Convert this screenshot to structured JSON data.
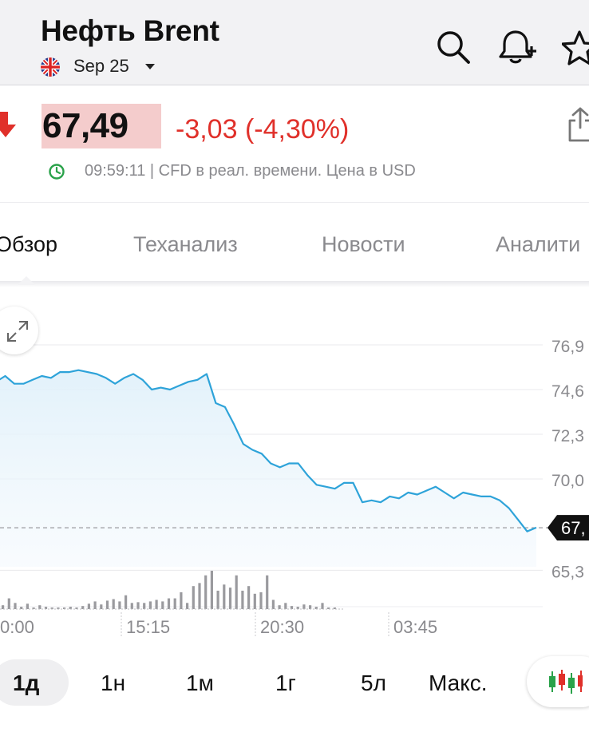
{
  "header": {
    "title": "Нефть Brent",
    "contract": "Sep 25"
  },
  "quote": {
    "price": "67,49",
    "change": "-3,03 (-4,30%)",
    "status": "09:59:11 | CFD в реал. времени. Цена в USD"
  },
  "tabs": [
    {
      "label": "Обзор",
      "active": true
    },
    {
      "label": "Теханализ",
      "active": false
    },
    {
      "label": "Новости",
      "active": false
    },
    {
      "label": "Аналити",
      "active": false
    }
  ],
  "ranges": [
    "1д",
    "1н",
    "1м",
    "1г",
    "5л",
    "Макс."
  ],
  "active_range": "1д",
  "colors": {
    "negative": "#e0302a",
    "line": "#2ea3d9",
    "price_highlight": "#f4cccc",
    "header_bg": "#f2f2f4"
  },
  "icons": [
    "uk-flag-icon",
    "chevron-down-icon",
    "search-icon",
    "bell-plus-icon",
    "star-icon",
    "down-arrow-icon",
    "share-icon",
    "clock-icon",
    "expand-icon",
    "candlestick-icon"
  ],
  "chart_data": {
    "type": "line",
    "y_tick_labels": [
      "76,9",
      "74,6",
      "72,3",
      "70,0",
      "65,3"
    ],
    "y_ticks": [
      76.9,
      74.6,
      72.3,
      70.0,
      65.3
    ],
    "current_label": "67,",
    "current_value": 67.49,
    "x_tick_labels": [
      "0:00",
      "15:15",
      "20:30",
      "03:45"
    ],
    "ylim": [
      65.3,
      76.9
    ],
    "grid": true,
    "series": [
      {
        "values": [
          75.0,
          75.3,
          74.9,
          74.9,
          75.1,
          75.3,
          75.2,
          75.5,
          75.5,
          75.6,
          75.5,
          75.4,
          75.2,
          74.9,
          75.2,
          75.4,
          75.1,
          74.6,
          74.7,
          74.6,
          74.8,
          75.0,
          75.1,
          75.4,
          73.9,
          73.7,
          72.8,
          71.8,
          71.5,
          71.3,
          70.8,
          70.6,
          70.8,
          70.8,
          70.2,
          69.7,
          69.6,
          69.5,
          69.8,
          69.8,
          68.8,
          68.9,
          68.8,
          69.1,
          69.0,
          69.3,
          69.2,
          69.4,
          69.6,
          69.3,
          69.0,
          69.3,
          69.2,
          69.1,
          69.1,
          68.9,
          68.5,
          67.9,
          67.3,
          67.5
        ],
        "volume": [
          5,
          14,
          8,
          3,
          7,
          2,
          5,
          3,
          2,
          2,
          2,
          3,
          2,
          4,
          7,
          10,
          6,
          11,
          13,
          10,
          18,
          8,
          9,
          8,
          10,
          12,
          10,
          14,
          14,
          22,
          8,
          30,
          34,
          44,
          50,
          24,
          32,
          28,
          44,
          24,
          30,
          20,
          22,
          44,
          12,
          5,
          8,
          4,
          3,
          6,
          5,
          3,
          8,
          2,
          2
        ]
      }
    ]
  }
}
